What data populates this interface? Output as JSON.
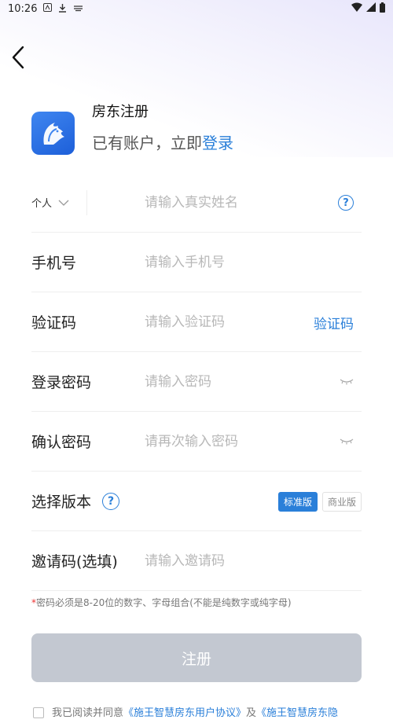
{
  "status_bar": {
    "time": "10:26",
    "left_icons": [
      "app-icon",
      "download-icon",
      "keyboard-icon"
    ],
    "right_icons": [
      "wifi-icon",
      "signal-icon",
      "battery-icon"
    ]
  },
  "header": {
    "title": "房东注册",
    "subtitle_prefix": "已有账户，立即",
    "login_link": "登录"
  },
  "form": {
    "type_select": {
      "selected": "个人"
    },
    "name": {
      "placeholder": "请输入真实姓名"
    },
    "phone": {
      "label": "手机号",
      "placeholder": "请输入手机号"
    },
    "code": {
      "label": "验证码",
      "placeholder": "请输入验证码",
      "button": "验证码"
    },
    "password": {
      "label": "登录密码",
      "placeholder": "请输入密码"
    },
    "confirm": {
      "label": "确认密码",
      "placeholder": "请再次输入密码"
    },
    "version": {
      "label": "选择版本",
      "options": [
        "标准版",
        "商业版"
      ],
      "selected": "标准版"
    },
    "invite": {
      "label": "邀请码(选填)",
      "placeholder": "请输入邀请码"
    }
  },
  "help_glyph": "?",
  "hint": {
    "star": "*",
    "text": "密码必须是8-20位的数字、字母组合(不能是纯数字或纯字母)"
  },
  "submit_label": "注册",
  "agreement": {
    "prefix": "我已阅读并同意",
    "link1": "《施王智慧房东用户协议》",
    "mid": "及",
    "link2": "《施王智慧房东隐"
  },
  "colors": {
    "accent": "#2a7fd9",
    "submit_disabled": "#c3c8d1",
    "logo": "#2f74e6"
  }
}
